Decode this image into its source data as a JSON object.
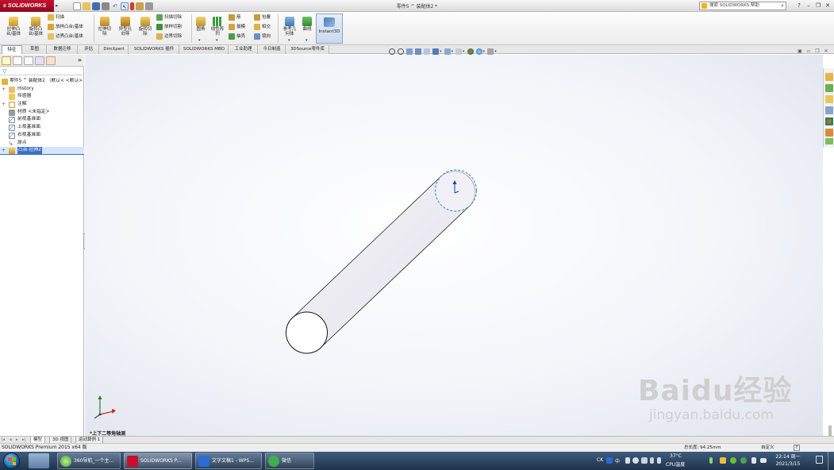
{
  "titlebar": {
    "app_name": "SOLIDWORKS",
    "doc_title": "零件5 ^ 装配体2 *",
    "help_search_placeholder": "搜索 SOLIDWORKS 帮助"
  },
  "ribbon": {
    "extrude_boss": "拉伸凸\n台/基体",
    "revolve_boss": "旋转凸\n台/基体",
    "sweep": "扫描",
    "loft_boss": "放样凸台/基体",
    "boundary_boss": "边界凸台/基体",
    "extrude_cut": "拉伸切\n除",
    "hole_wizard": "异型孔\n向导",
    "revolve_cut": "旋转切\n除",
    "swept_cut": "扫描切除",
    "lofted_cut": "放样切割",
    "boundary_cut": "边界切除",
    "fillet": "圆角",
    "linear_pattern": "线性阵\n列",
    "rib": "筋",
    "draft": "拔模",
    "shell": "抽壳",
    "wrap": "包覆",
    "intersect": "相交",
    "mirror": "镜向",
    "reference_geometry": "参考几\n何体",
    "curves": "曲线",
    "instant3d": "Instant3D"
  },
  "command_tabs": [
    "特征",
    "草图",
    "数据迁移",
    "评估",
    "DimXpert",
    "SOLIDWORKS 插件",
    "SOLIDWORKS MBD",
    "工业助理",
    "今日制造",
    "3DSource零件库"
  ],
  "feature_tree": {
    "root": "零件5 ^ 装配体2 （默认< <默认>",
    "items": [
      "History",
      "传感器",
      "注解",
      "材质 <未指定>",
      "前视基准面",
      "上视基准面",
      "右视基准面",
      "原点",
      "凸台-拉伸2"
    ]
  },
  "viewport": {
    "view_label": "*上下二等角轴测",
    "watermark_main": "Baidu经验",
    "watermark_sub": "jingyan.baidu.com"
  },
  "model_tabs": [
    "模型",
    "3D 视图",
    "运动算例 1"
  ],
  "statusbar": {
    "version": "SOLIDWORKS Premium 2015 x64 版",
    "measurement": "总长度: 94.25mm",
    "customize": "自定义",
    "help": "?"
  },
  "taskbar": {
    "apps": [
      "360导航_一个主...",
      "SOLIDWORKS P...",
      "文字文稿1 - WPS...",
      "微信"
    ],
    "tray_lang": "CK",
    "tray_ime": "中",
    "temperature": "37°C",
    "cpu_label": "CPU温度",
    "time": "22:14 周一",
    "date": "2021/3/15"
  },
  "colors": {
    "solidworks_red": "#c8102e",
    "selection_blue": "#3b6fc7",
    "cylinder_body": "#efedf4",
    "edge_dashed": "#3a7bd5"
  }
}
